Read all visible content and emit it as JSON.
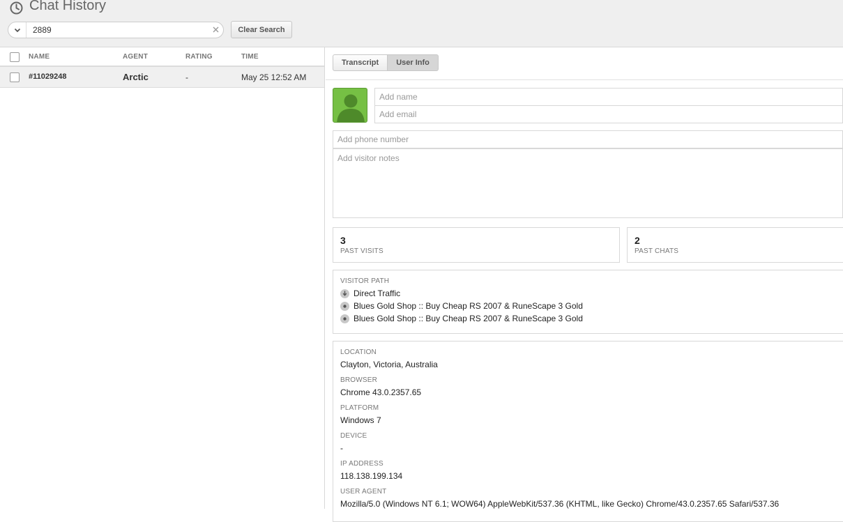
{
  "header": {
    "title": "Chat History",
    "icon": "clock-icon",
    "search": {
      "value": "2889",
      "placeholder": ""
    },
    "clear_search_label": "Clear Search"
  },
  "list": {
    "columns": {
      "name": "NAME",
      "agent": "AGENT",
      "rating": "RATING",
      "time": "TIME"
    },
    "rows": [
      {
        "name": "#11029248",
        "agent": "Arctic",
        "rating": "-",
        "time": "May 25 12:52 AM"
      }
    ]
  },
  "detail": {
    "tabs": [
      {
        "label": "Transcript"
      },
      {
        "label": "User Info"
      }
    ],
    "active_tab": "User Info",
    "placeholders": {
      "name": "Add name",
      "email": "Add email",
      "phone": "Add phone number",
      "notes": "Add visitor notes"
    },
    "stats": {
      "past_visits": {
        "value": "3",
        "label": "PAST VISITS"
      },
      "past_chats": {
        "value": "2",
        "label": "PAST CHATS"
      }
    },
    "visitor_path": {
      "label": "VISITOR PATH",
      "items": [
        {
          "text": "Direct Traffic",
          "icon": "arrow-down-icon"
        },
        {
          "text": "Blues Gold Shop :: Buy Cheap RS 2007 & RuneScape 3 Gold",
          "icon": "dot-icon"
        },
        {
          "text": "Blues Gold Shop :: Buy Cheap RS 2007 & RuneScape 3 Gold",
          "icon": "dot-icon"
        }
      ]
    },
    "info": {
      "location_label": "LOCATION",
      "location": "Clayton, Victoria, Australia",
      "browser_label": "BROWSER",
      "browser": "Chrome 43.0.2357.65",
      "platform_label": "PLATFORM",
      "platform": "Windows 7",
      "device_label": "DEVICE",
      "device": "-",
      "ip_label": "IP ADDRESS",
      "ip": "118.138.199.134",
      "ua_label": "USER AGENT",
      "ua": "Mozilla/5.0 (Windows NT 6.1; WOW64) AppleWebKit/537.36 (KHTML, like Gecko) Chrome/43.0.2357.65 Safari/537.36"
    }
  },
  "colors": {
    "avatar_green": "#76c044",
    "topbar_bg": "#efefef"
  }
}
